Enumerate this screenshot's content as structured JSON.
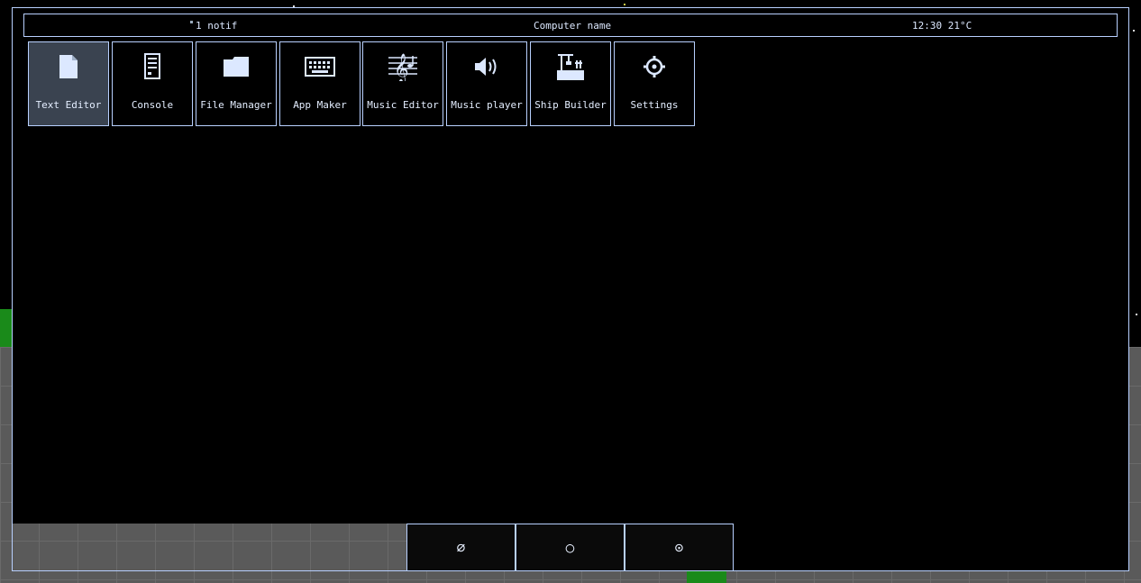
{
  "topbar": {
    "notifications": "1 notif",
    "computer_name": "Computer name",
    "clock_weather": "12:30 21°C"
  },
  "apps": [
    {
      "label": "Text Editor",
      "icon": "document-icon",
      "active": true
    },
    {
      "label": "Console",
      "icon": "console-icon"
    },
    {
      "label": "File Manager",
      "icon": "folder-icon"
    },
    {
      "label": "App Maker",
      "icon": "keyboard-icon"
    },
    {
      "label": "Music Editor",
      "icon": "music-staff-icon"
    },
    {
      "label": "Music player",
      "icon": "speaker-icon"
    },
    {
      "label": "Ship Builder",
      "icon": "crane-icon"
    },
    {
      "label": "Settings",
      "icon": "gear-icon"
    }
  ],
  "dock": [
    {
      "glyph": "∅",
      "icon": "empty-set-icon"
    },
    {
      "glyph": "○",
      "icon": "circle-icon"
    },
    {
      "glyph": "⊙",
      "icon": "settings-icon"
    }
  ],
  "colors": {
    "accent_border": "#b8d0ff",
    "active_app_bg": "#3a4350",
    "background": "#000000"
  }
}
